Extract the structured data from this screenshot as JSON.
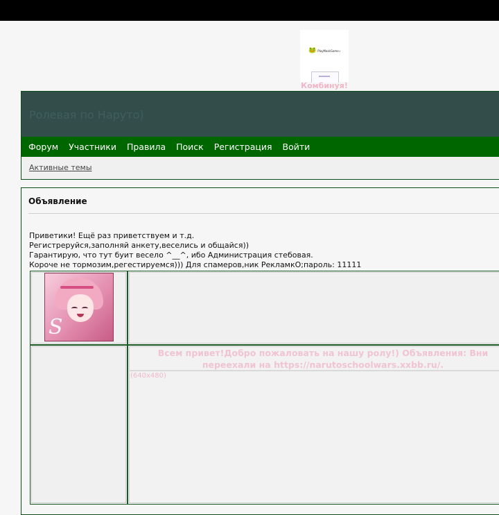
{
  "banner": {
    "logo_mark": "🐸",
    "logo_text": "PlayMaskGame.com",
    "caption": "Комбинуя!"
  },
  "header": {
    "site_title": "Ролевая по Наруто)"
  },
  "nav": {
    "items": [
      {
        "label": "Форум"
      },
      {
        "label": "Участники"
      },
      {
        "label": "Правила"
      },
      {
        "label": "Поиск"
      },
      {
        "label": "Регистрация"
      },
      {
        "label": "Войти"
      }
    ],
    "active_topics": "Активные темы"
  },
  "announcement": {
    "title": "Объявление",
    "lines": [
      "Приветики! Ещё раз приветствуем и т.д.",
      "Регистреруйся,заполняй анкету,веселись и общайся))",
      "Гарантирую, что тут буит весело ^__^, ибо Администрация стебовая.",
      "Короче не тормозим,регестируемся))) Для спамеров,ник РекламкО;пароль: 11111"
    ],
    "welcome_line1": "Всем привет!Добро пожаловать на нашу ролу!) Объявления: Вни",
    "welcome_line2": "переехали на https://narutoschoolwars.xxbb.ru/.",
    "image_size": "(640x480)"
  },
  "icons": {
    "avatar": "anime-avatar-sakura",
    "banner_logo": "frog-logo-icon"
  },
  "colors": {
    "nav_bg": "#006600",
    "title_band": "#334d4b",
    "border": "#0d4d16",
    "accent_pink": "#f0b6c8"
  }
}
